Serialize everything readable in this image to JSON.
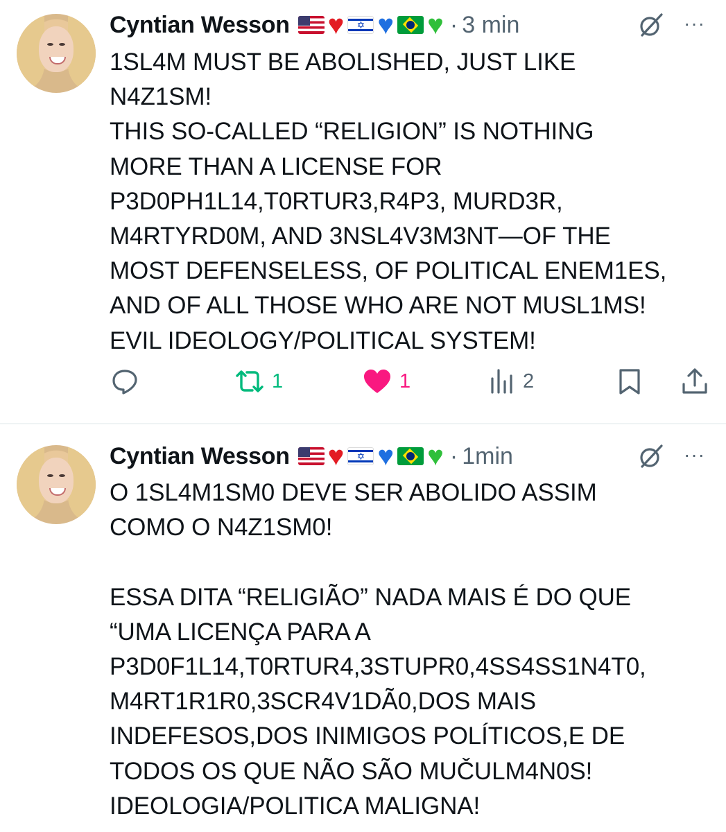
{
  "posts": [
    {
      "author": "Cyntian Wesson",
      "separator": "·",
      "time": "3 min",
      "more": "···",
      "text": "1SL4M MUST BE ABOLISHED, JUST LIKE\nN4Z1SM!\nTHIS SO-CALLED “RELIGION” IS NOTHING\nMORE THAN A LICENSE FOR\nP3D0PH1L14,T0RTUR3,R4P3, MURD3R,\nM4RTYRD0M, AND 3NSL4V3M3NT—OF THE\nMOST DEFENSELESS, OF POLITICAL ENEM1ES,\nAND OF ALL THOSE WHO ARE NOT MUSL1MS!\nEVIL IDEOLOGY/POLITICAL SYSTEM!",
      "reposts": "1",
      "likes": "1",
      "views": "2"
    },
    {
      "author": "Cyntian Wesson",
      "separator": "·",
      "time": "1min",
      "more": "···",
      "text": "O 1SL4M1SM0 DEVE SER ABOLIDO ASSIM\nCOMO O N4Z1SM0!\n\nESSA DITA “RELIGIÃO” NADA MAIS É DO QUE\n“UMA LICENÇA PARA A\nP3D0F1L14,T0RTUR4,3STUPR0,4SS4SS1N4T0,\nM4RT1R1R0,3SCR4V1DÃ0,DOS MAIS\nINDEFESOS,DOS INIMIGOS POLÍTICOS,E DE\nTODOS OS QUE NÃO SÃO MUČULM4N0S!\nIDEOLOGIA/POLITICA MALIGNA!"
    }
  ],
  "badges": [
    {
      "type": "flag",
      "name": "us-flag"
    },
    {
      "type": "heart",
      "name": "red-heart",
      "color": "#e31b23"
    },
    {
      "type": "flag",
      "name": "israel-flag"
    },
    {
      "type": "heart",
      "name": "blue-heart",
      "color": "#1e6fe0"
    },
    {
      "type": "flag",
      "name": "brazil-flag"
    },
    {
      "type": "heart",
      "name": "green-heart",
      "color": "#2fbf3a"
    }
  ],
  "icons": {
    "reply": "speech-bubble-icon",
    "repost": "repost-arrows-icon",
    "like": "heart-filled-icon",
    "views": "bar-chart-icon",
    "bookmark": "bookmark-icon",
    "share": "share-upload-icon",
    "grok": "grok-icon"
  },
  "colors": {
    "text": "#0f1419",
    "muted": "#536471",
    "repost_active": "#00ba7c",
    "like_active": "#f91880",
    "divider": "#eff3f4"
  }
}
